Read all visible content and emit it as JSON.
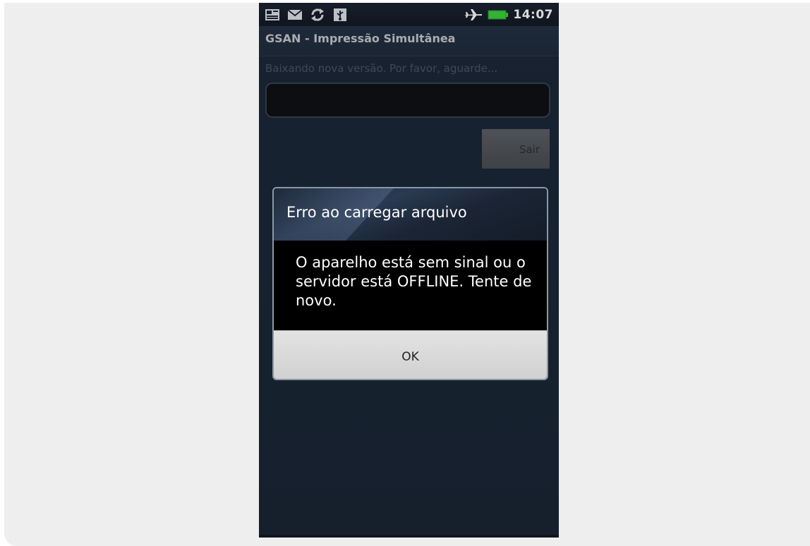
{
  "statusbar": {
    "icons_left": [
      "notification-icon",
      "mail-icon",
      "sync-icon",
      "usb-icon"
    ],
    "icons_right": [
      "airplane-mode-icon",
      "battery-icon"
    ],
    "time": "14:07",
    "battery_color": "#3ed23e"
  },
  "app": {
    "title": "GSAN - Impressão Simultânea",
    "status_text": "Baixando nova versão. Por favor, aguarde...",
    "exit_button": "Sair"
  },
  "dialog": {
    "title": "Erro ao carregar arquivo",
    "message": "O aparelho está sem sinal ou o servidor está OFFLINE. Tente de novo.",
    "ok_button": "OK"
  }
}
